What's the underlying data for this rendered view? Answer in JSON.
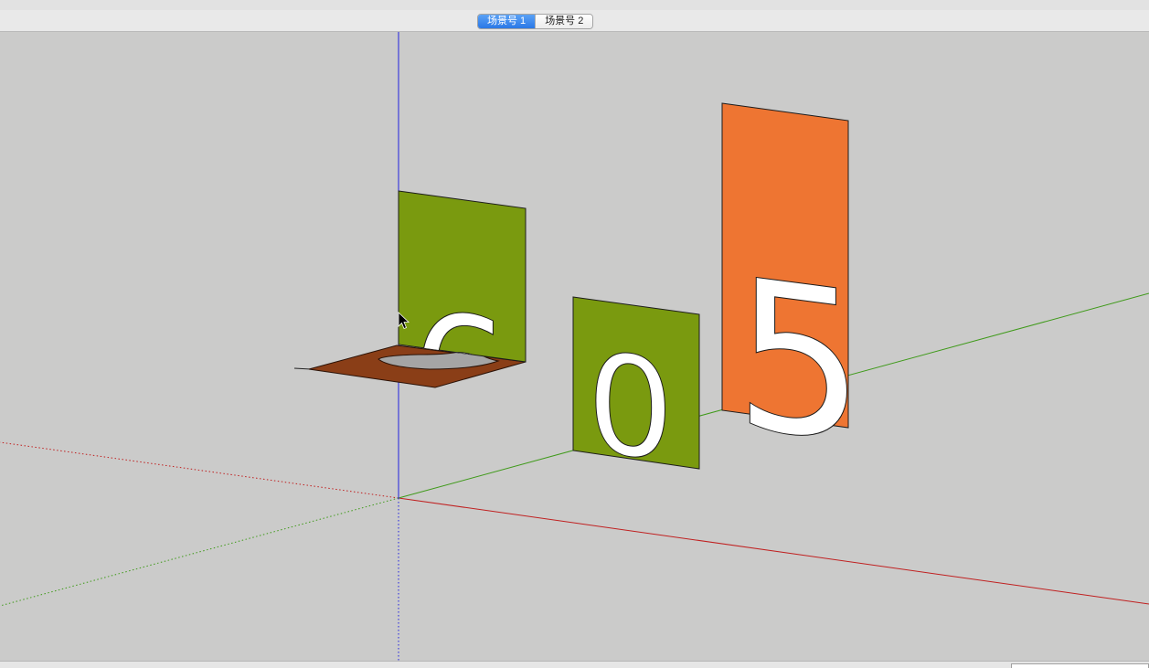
{
  "scene_tabs": [
    {
      "label": "场景号 1",
      "active": true
    },
    {
      "label": "场景号 2",
      "active": false
    }
  ],
  "model": {
    "panels": [
      {
        "name": "green-panel-6",
        "color": "#7a9a0f",
        "digit": "6"
      },
      {
        "name": "green-panel-0",
        "color": "#7a9a0f",
        "digit": "0"
      },
      {
        "name": "orange-panel-5",
        "color": "#ee7532",
        "digit": "5"
      }
    ],
    "floor_tile_color": "#8a3e17"
  },
  "axes": {
    "red": "#c02020",
    "green": "#3f9a1a",
    "blue": "#2020e0"
  },
  "viewport_background": "#cbcbca",
  "cursor": "arrow-cursor-icon"
}
